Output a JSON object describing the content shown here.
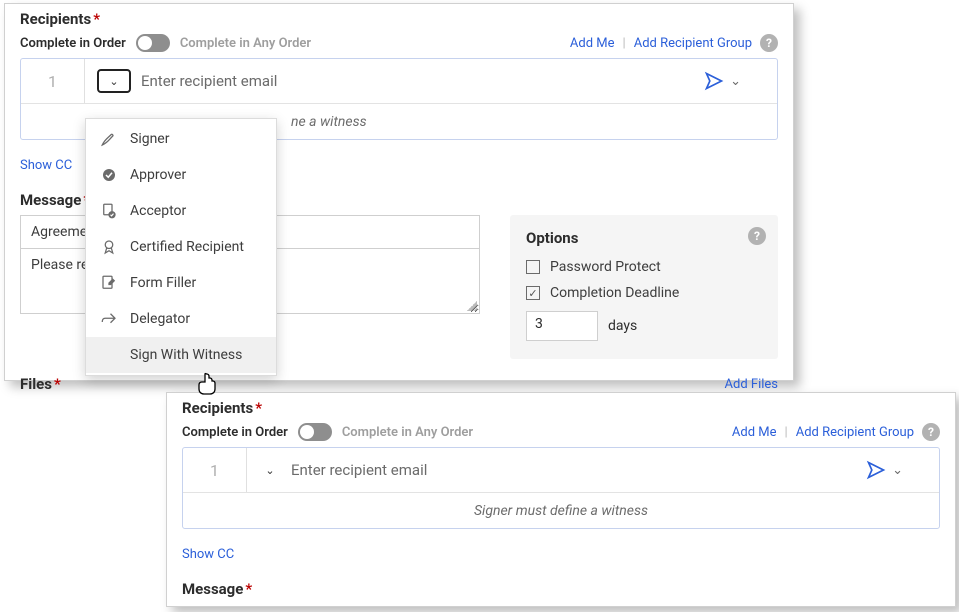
{
  "panel1": {
    "recipients_title": "Recipients",
    "complete_order_label": "Complete in Order",
    "complete_any_label": "Complete in Any Order",
    "add_me": "Add Me",
    "add_group": "Add Recipient Group",
    "recipient_number": "1",
    "email_placeholder": "Enter recipient email",
    "witness_hint_partial": "ne a witness",
    "show_cc": "Show CC",
    "message_title": "Message",
    "message_subject": "Agreeme",
    "message_body": "Please rev",
    "options": {
      "title": "Options",
      "password": "Password Protect",
      "deadline": "Completion Deadline",
      "days_value": "3",
      "days_label": "days"
    },
    "files_label": "Files",
    "add_files": "Add Files"
  },
  "dropdown": {
    "items": [
      {
        "icon": "pen-icon",
        "label": "Signer"
      },
      {
        "icon": "check-circle-icon",
        "label": "Approver"
      },
      {
        "icon": "doc-check-icon",
        "label": "Acceptor"
      },
      {
        "icon": "ribbon-icon",
        "label": "Certified Recipient"
      },
      {
        "icon": "doc-edit-icon",
        "label": "Form Filler"
      },
      {
        "icon": "forward-icon",
        "label": "Delegator"
      },
      {
        "icon": "blank-icon",
        "label": "Sign With Witness"
      }
    ]
  },
  "panel2": {
    "recipients_title": "Recipients",
    "complete_order_label": "Complete in Order",
    "complete_any_label": "Complete in Any Order",
    "add_me": "Add Me",
    "add_group": "Add Recipient Group",
    "recipient_number": "1",
    "email_placeholder": "Enter recipient email",
    "witness_hint_full": "Signer must define a witness",
    "show_cc": "Show CC",
    "message_title": "Message"
  }
}
